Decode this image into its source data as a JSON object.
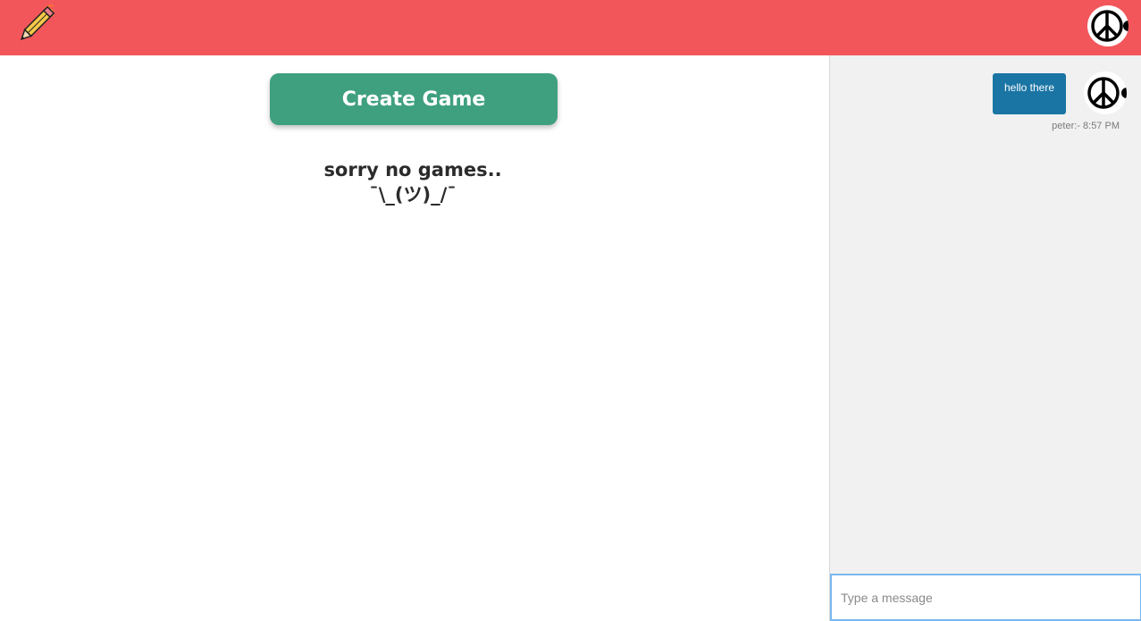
{
  "navbar": {
    "logo_icon": "pencil-rocket-icon",
    "avatar_icon": "peace-sign-icon",
    "color": "#f2565b"
  },
  "main": {
    "create_button_label": "Create Game",
    "create_button_color": "#3fa07f",
    "empty_message": "sorry no games..",
    "shrug": "¯\\_(ツ)_/¯"
  },
  "chat": {
    "messages": [
      {
        "text": "hello there",
        "meta": "peter:- 8:57 PM",
        "avatar_icon": "peace-sign-icon",
        "bubble_color": "#1a75a4"
      }
    ],
    "input_placeholder": "Type a message"
  }
}
